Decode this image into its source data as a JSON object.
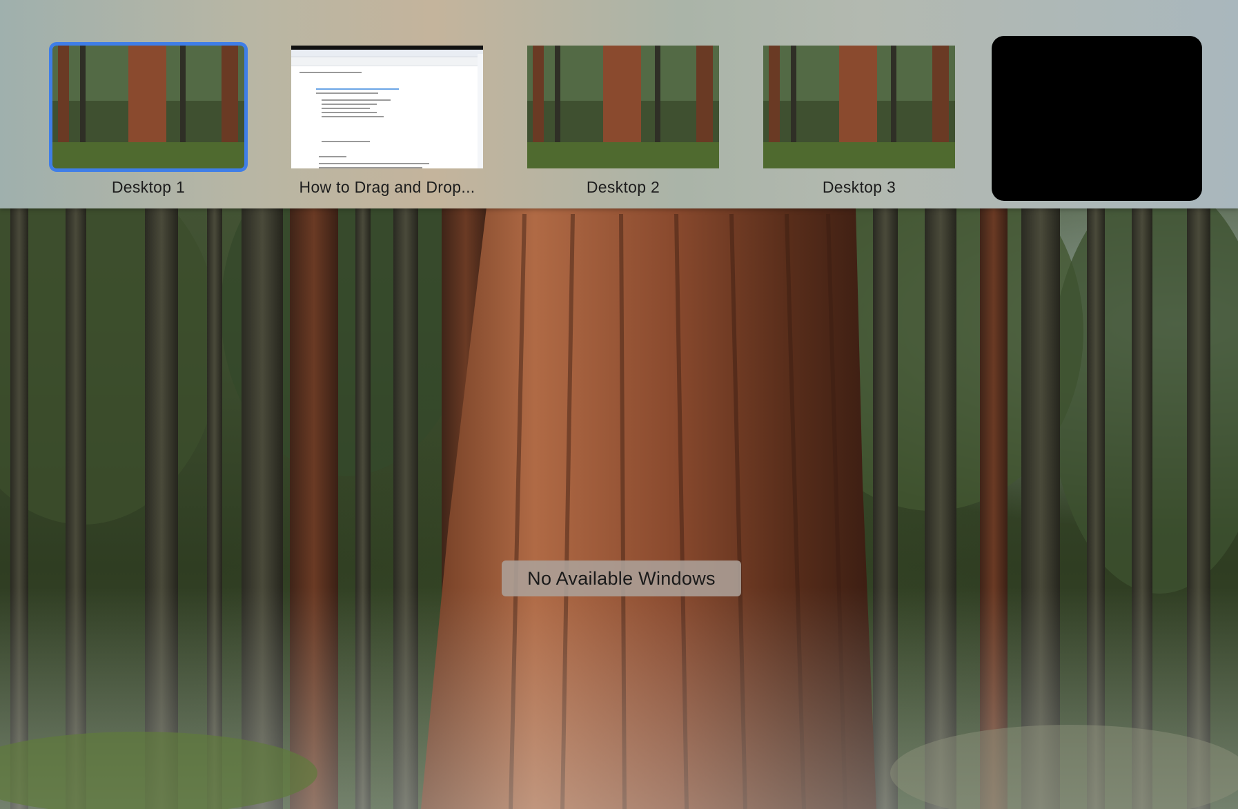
{
  "spaces_bar": {
    "spaces": [
      {
        "label": "Desktop 1",
        "selected": true,
        "thumbnail": "forest-wallpaper"
      },
      {
        "label": "How to Drag and Drop...",
        "selected": false,
        "thumbnail": "document-window"
      },
      {
        "label": "Desktop 2",
        "selected": false,
        "thumbnail": "forest-wallpaper"
      },
      {
        "label": "Desktop 3",
        "selected": false,
        "thumbnail": "forest-wallpaper"
      }
    ],
    "add_space_tile_color": "#000000"
  },
  "main": {
    "notice": "No Available Windows"
  },
  "colors": {
    "selection_accent": "#3f7ee8",
    "notice_background": "#aca098"
  }
}
